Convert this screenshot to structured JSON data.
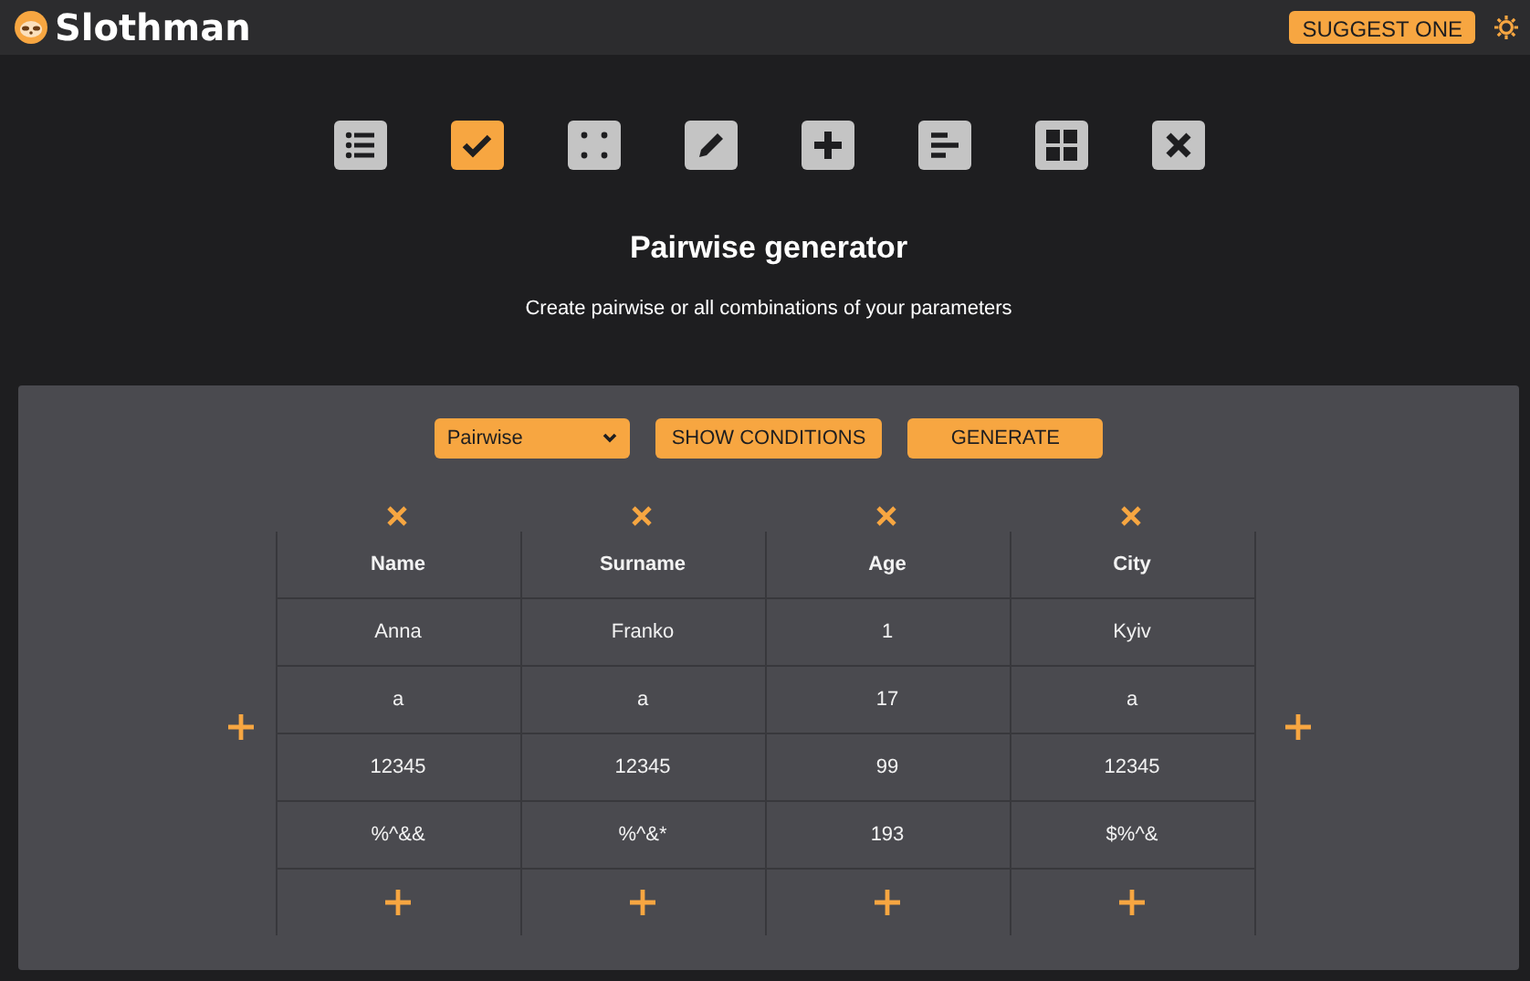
{
  "header": {
    "brand": "Slothman",
    "suggest_button": "SUGGEST ONE"
  },
  "tools": [
    {
      "kind": "list",
      "selected": false
    },
    {
      "kind": "check",
      "selected": true
    },
    {
      "kind": "dice",
      "selected": false
    },
    {
      "kind": "pencil",
      "selected": false
    },
    {
      "kind": "plus",
      "selected": false
    },
    {
      "kind": "bars",
      "selected": false
    },
    {
      "kind": "grid",
      "selected": false
    },
    {
      "kind": "cross",
      "selected": false
    }
  ],
  "title": "Pairwise generator",
  "subtitle": "Create pairwise or all combinations of your parameters",
  "controls": {
    "mode": "Pairwise",
    "show_conditions": "SHOW CONDITIONS",
    "generate": "GENERATE"
  },
  "table": {
    "columns": [
      "Name",
      "Surname",
      "Age",
      "City"
    ],
    "rows": [
      [
        "Anna",
        "Franko",
        "1",
        "Kyiv"
      ],
      [
        "a",
        "a",
        "17",
        "a"
      ],
      [
        "12345",
        "12345",
        "99",
        "12345"
      ],
      [
        "%^&&",
        "%^&*",
        "193",
        "$%^&"
      ]
    ]
  }
}
